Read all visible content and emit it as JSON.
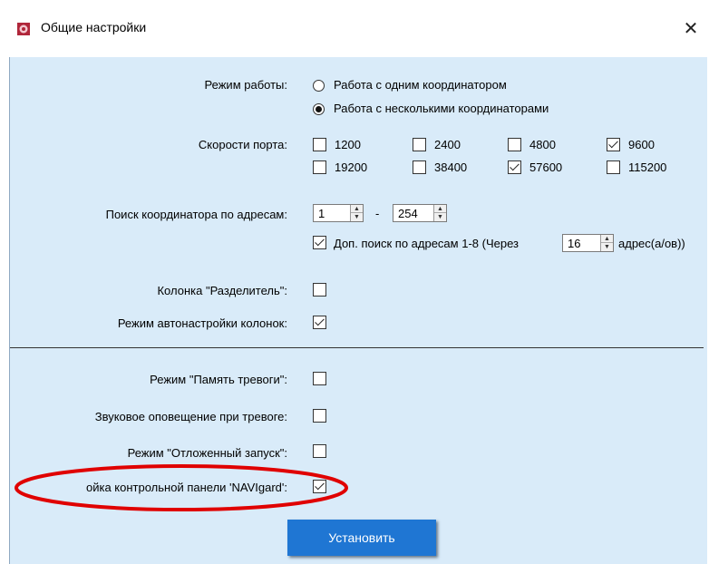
{
  "window": {
    "title": "Общие настройки",
    "close_glyph": "✕"
  },
  "work_mode": {
    "label": "Режим работы:",
    "options": [
      {
        "label": "Работа с одним координатором",
        "selected": false
      },
      {
        "label": "Работа с несколькими координаторами",
        "selected": true
      }
    ]
  },
  "port_speeds": {
    "label": "Скорости порта:",
    "options": [
      {
        "label": "1200",
        "checked": false
      },
      {
        "label": "2400",
        "checked": false
      },
      {
        "label": "4800",
        "checked": false
      },
      {
        "label": "9600",
        "checked": true
      },
      {
        "label": "19200",
        "checked": false
      },
      {
        "label": "38400",
        "checked": false
      },
      {
        "label": "57600",
        "checked": true
      },
      {
        "label": "115200",
        "checked": false
      }
    ]
  },
  "address_search": {
    "label": "Поиск координатора по адресам:",
    "from": "1",
    "dash": "-",
    "to": "254",
    "extra_label": "Доп. поиск по адресам 1-8  (Через",
    "extra_checked": true,
    "every": "16",
    "suffix": "адрес(а/ов))"
  },
  "separator_column": {
    "label": "Колонка \"Разделитель\":",
    "checked": false
  },
  "auto_columns": {
    "label": "Режим автонастройки колонок:",
    "checked": true
  },
  "alarm_memory": {
    "label": "Режим \"Память тревоги\":",
    "checked": false
  },
  "sound_alarm": {
    "label": "Звуковое оповещение при тревоге:",
    "checked": false
  },
  "delayed_start": {
    "label": "Режим \"Отложенный запуск\":",
    "checked": false
  },
  "navigard_panel": {
    "label": "ойка контрольной панели 'NAVIgard':",
    "checked": true
  },
  "apply_button": "Установить",
  "colors": {
    "client_bg": "#d9ebf9",
    "button_bg": "#1f76d3",
    "highlight": "#e00000"
  }
}
